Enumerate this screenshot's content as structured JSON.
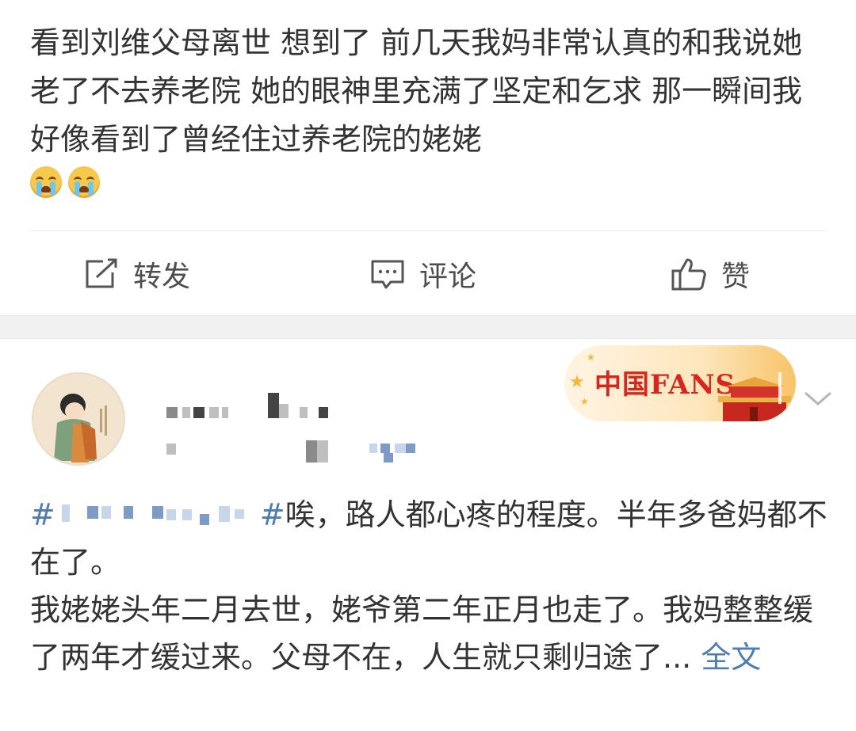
{
  "post1": {
    "text": "看到刘维父母离世 想到了 前几天我妈非常认真的和我说她老了不去养老院 她的眼神里充满了坚定和乞求 那一瞬间我好像看到了曾经住过养老院的姥姥",
    "emojis": [
      "crying-face",
      "crying-face"
    ],
    "actions": {
      "repost": "转发",
      "comment": "评论",
      "like": "赞"
    }
  },
  "post2": {
    "badge_text": "中国FANS",
    "topic_start": "#",
    "topic_end": "#",
    "body_after_topic": "唉，路人都心疼的程度。半年多爸妈都不在了。",
    "body_line2": "我姥姥头年二月去世，姥爷第二年正月也走了。我妈整整缓了两年才缓过来。父母不在，人生就只剩归途了...",
    "more_label": "全文"
  },
  "colors": {
    "link": "#507daf",
    "text": "#333333",
    "action_text": "#4d4d4d",
    "badge_red": "#d7261e",
    "separator": "#f1f1f1"
  }
}
